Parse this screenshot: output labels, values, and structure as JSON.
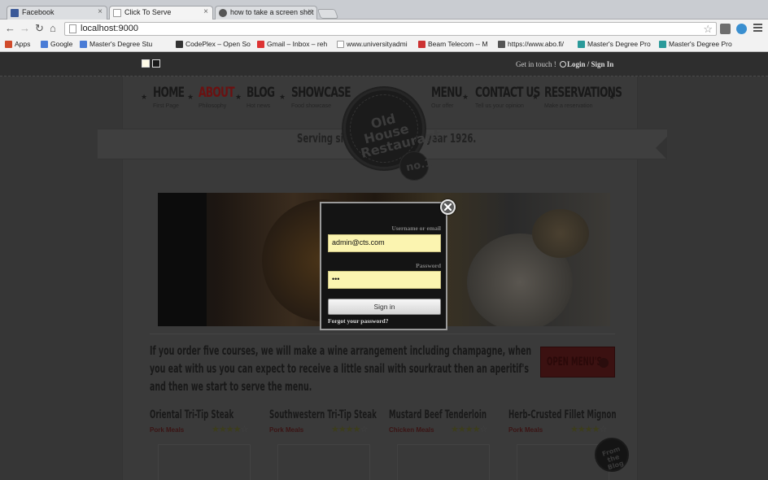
{
  "browser": {
    "tabs": [
      {
        "title": "Facebook",
        "icon": "facebook-icon",
        "active": false
      },
      {
        "title": "Click To Serve",
        "icon": "page-icon",
        "active": true
      },
      {
        "title": "how to take a screen shot",
        "icon": "apple-icon",
        "active": false
      }
    ],
    "tab_close": "×",
    "url": "localhost:9000",
    "bookmarks": [
      {
        "label": "Apps",
        "icon": "apps-icon"
      },
      {
        "label": "Google",
        "icon": "google-icon"
      },
      {
        "label": "Master's Degree Stu",
        "icon": "bookmark-icon"
      },
      {
        "label": "CodePlex – Open So",
        "icon": "codeplex-icon"
      },
      {
        "label": "Gmail – Inbox – reh",
        "icon": "gmail-icon"
      },
      {
        "label": "www.universityadmi",
        "icon": "page-icon"
      },
      {
        "label": "Beam Telecom -- M",
        "icon": "beam-icon"
      },
      {
        "label": "https://www.abo.fi/",
        "icon": "abo-icon"
      },
      {
        "label": "Master's Degree Pro",
        "icon": "bookmark-icon"
      },
      {
        "label": "Master's Degree Pro",
        "icon": "bookmark-icon"
      }
    ]
  },
  "site": {
    "topbar": {
      "get_in_touch": "Get in touch !",
      "login": "Login / Sign In"
    },
    "nav": [
      {
        "label": "HOME",
        "sub": "First Page"
      },
      {
        "label": "ABOUT",
        "sub": "Philosophy"
      },
      {
        "label": "BLOG",
        "sub": "Hot news"
      },
      {
        "label": "SHOWCASE",
        "sub": "Food showcase"
      },
      {
        "label": "MENU",
        "sub": "Our offer"
      },
      {
        "label": "CONTACT US",
        "sub": "Tell us your opinion"
      },
      {
        "label": "RESERVATIONS",
        "sub": "Make a reservation"
      }
    ],
    "logo": {
      "line1": "Old House",
      "line2": "Restaurant",
      "badge": "no.1"
    },
    "tagline": {
      "left": "Serving since",
      "right": "year 1926."
    },
    "promo": "If you order five courses, we will make a wine arrangement including champagne, when you eat with us you can expect to receive a little snail with sourkraut then an aperitif's and then we start to serve the menu.",
    "open_menu_button": "OPEN MENU'S",
    "cards": [
      {
        "title": "Oriental Tri-Tip Steak",
        "category": "Pork Meals",
        "rating": 4
      },
      {
        "title": "Southwestern Tri-Tip Steak",
        "category": "Pork Meals",
        "rating": 4
      },
      {
        "title": "Mustard Beef Tenderloin",
        "category": "Chicken Meals",
        "rating": 4
      },
      {
        "title": "Herb-Crusted Fillet Mignon",
        "category": "Pork Meals",
        "rating": 4
      }
    ],
    "blog_badge": "From the Blog"
  },
  "modal": {
    "username_label": "Username or email",
    "username_value": "admin@cts.com",
    "password_label": "Password",
    "password_value": "•••",
    "sign_in": "Sign in",
    "forgot": "Forgot your password?"
  },
  "colors": {
    "accent_red": "#6a1111",
    "input_bg": "#fbf4b0",
    "overlay": "#363636"
  }
}
